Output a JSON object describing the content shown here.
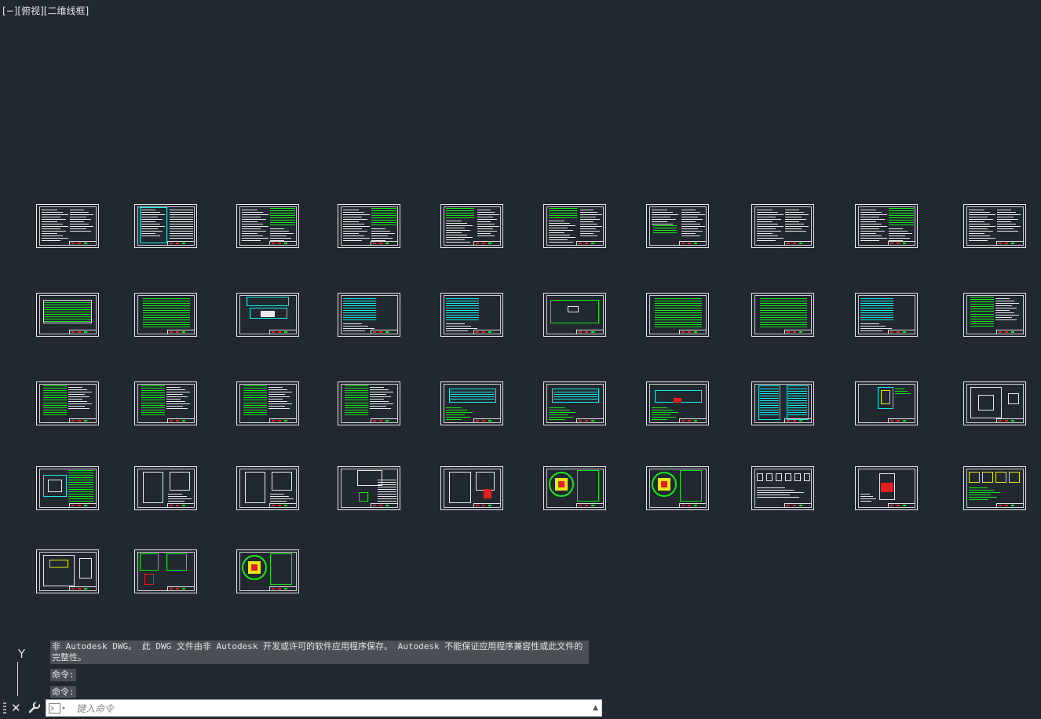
{
  "viewport": {
    "view_control": "[−]",
    "view_name": "[俯视]",
    "visual_style": "[二维线框]"
  },
  "command_history": {
    "message": "非 Autodesk DWG。 此 DWG 文件由非 Autodesk 开发或许可的软件应用程序保存。 Autodesk 不能保证应用程序兼容性或此文件的完整性。",
    "lines": [
      "命令:",
      "命令:"
    ]
  },
  "ucs": {
    "y_label": "Y"
  },
  "command_bar": {
    "input_placeholder": "键入命令"
  },
  "colors": {
    "background": "#212830",
    "sheet_border": "#e8e8e8",
    "green": "#19e619",
    "cyan": "#19e6e6",
    "yellow": "#e6e619",
    "red": "#e02020"
  },
  "sheets": [
    {
      "type": "text"
    },
    {
      "type": "cyan-table"
    },
    {
      "type": "text-green-right"
    },
    {
      "type": "text-green-right"
    },
    {
      "type": "text-small-green"
    },
    {
      "type": "text-small-green"
    },
    {
      "type": "text-green-mid"
    },
    {
      "type": "text"
    },
    {
      "type": "text-green-right"
    },
    {
      "type": "text"
    },
    {
      "type": "green-table"
    },
    {
      "type": "green-full"
    },
    {
      "type": "cyan-schematic"
    },
    {
      "type": "cyan-grid"
    },
    {
      "type": "cyan-grid"
    },
    {
      "type": "green-plan"
    },
    {
      "type": "green-full"
    },
    {
      "type": "green-full"
    },
    {
      "type": "cyan-grid"
    },
    {
      "type": "green-list"
    },
    {
      "type": "green-list"
    },
    {
      "type": "green-list"
    },
    {
      "type": "green-list"
    },
    {
      "type": "green-list"
    },
    {
      "type": "cyan-rect"
    },
    {
      "type": "cyan-rect"
    },
    {
      "type": "cyan-rect-red"
    },
    {
      "type": "cyan-grid2"
    },
    {
      "type": "cyan-small"
    },
    {
      "type": "white-plan"
    },
    {
      "type": "cyan-box-green"
    },
    {
      "type": "white-detail"
    },
    {
      "type": "white-detail"
    },
    {
      "type": "green-detail"
    },
    {
      "type": "white-detail-red"
    },
    {
      "type": "yellow-red-circle"
    },
    {
      "type": "yellow-red-circle"
    },
    {
      "type": "white-trees"
    },
    {
      "type": "red-block"
    },
    {
      "type": "yellow-detail"
    },
    {
      "type": "white-plan-yellow"
    },
    {
      "type": "green-frame"
    },
    {
      "type": "yellow-red-circle"
    }
  ]
}
